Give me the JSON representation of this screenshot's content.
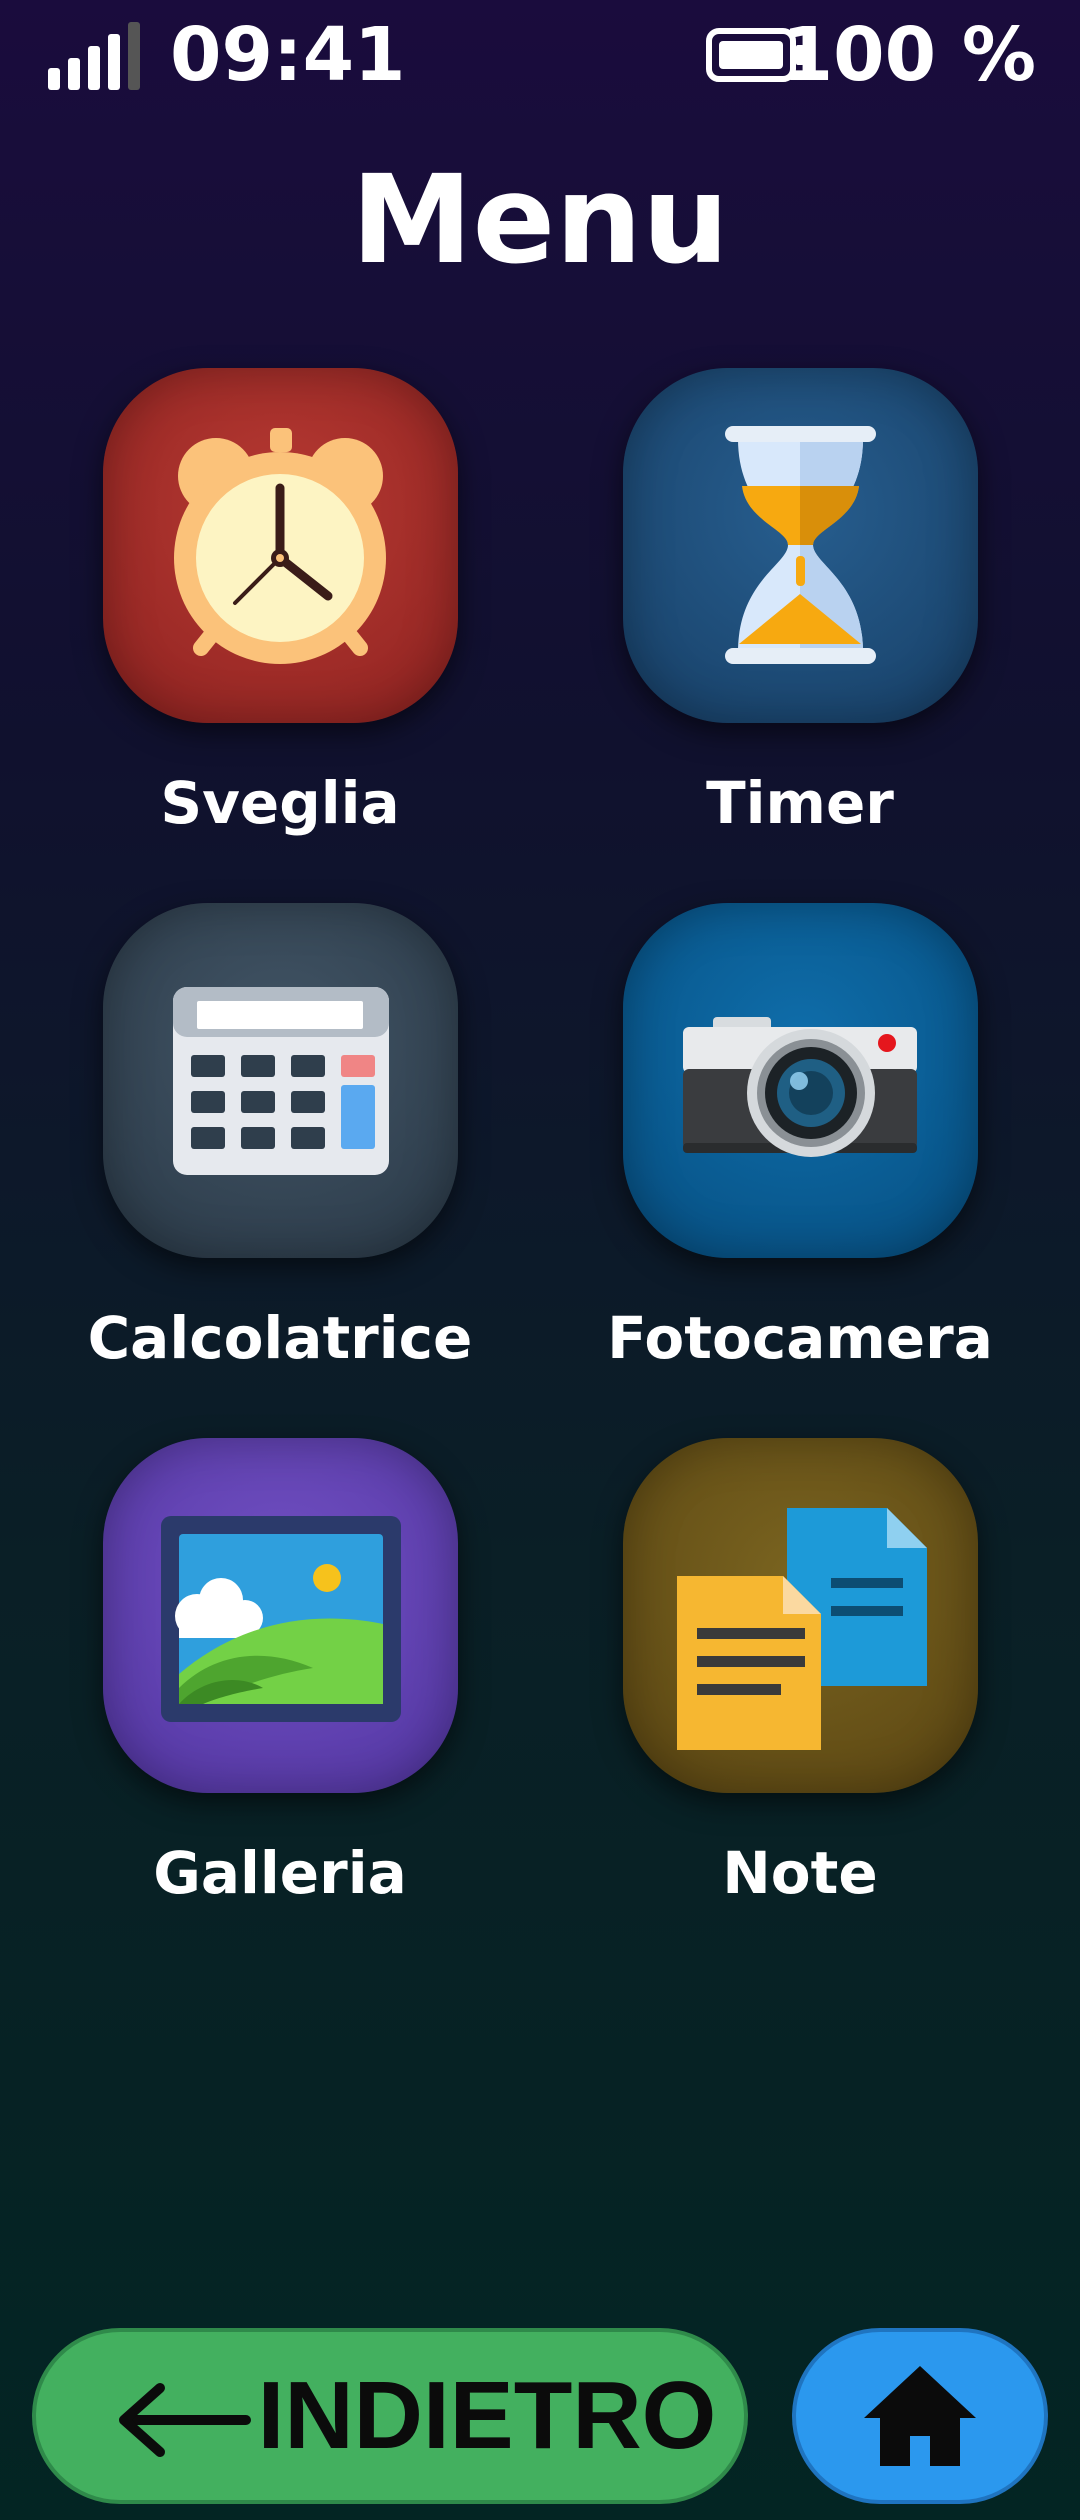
{
  "status_bar": {
    "time": "09:41",
    "battery_percent": "100 %",
    "battery_level": 1.0,
    "signal_level_bars": 4,
    "signal_max_bars": 5
  },
  "page": {
    "title": "Menu"
  },
  "apps": [
    {
      "label": "Sveglia",
      "icon": "alarm-clock-icon",
      "bg": "#a92a27"
    },
    {
      "label": "Timer",
      "icon": "hourglass-icon",
      "bg": "#1e5381"
    },
    {
      "label": "Calcolatrice",
      "icon": "calculator-icon",
      "bg": "#374856"
    },
    {
      "label": "Fotocamera",
      "icon": "camera-icon",
      "bg": "#0a609a"
    },
    {
      "label": "Galleria",
      "icon": "gallery-image-icon",
      "bg": "#6440b5"
    },
    {
      "label": "Note",
      "icon": "notes-documents-icon",
      "bg": "#6b5516"
    }
  ],
  "nav": {
    "back_label": "INDIETRO",
    "back_icon": "arrow-left-icon",
    "back_color": "#43b05f",
    "home_icon": "home-icon",
    "home_color": "#2b98ee"
  }
}
